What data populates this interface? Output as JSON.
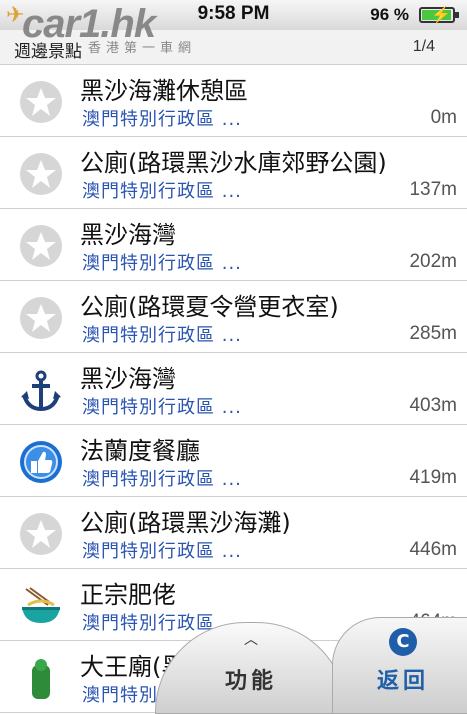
{
  "status_bar": {
    "time": "9:58 PM",
    "battery": "96 %"
  },
  "watermark": {
    "logo": "car1.hk",
    "subtitle": "香港第一車網"
  },
  "header": {
    "title": "週邊景點",
    "page": "1/4"
  },
  "list": [
    {
      "icon": "star-icon",
      "name": "黑沙海灘休憩區",
      "region": "澳門特別行政區 ...",
      "distance": "0m"
    },
    {
      "icon": "star-icon",
      "name": "公廁(路環黑沙水庫郊野公園)",
      "region": "澳門特別行政區 ...",
      "distance": "137m"
    },
    {
      "icon": "star-icon",
      "name": "黑沙海灣",
      "region": "澳門特別行政區 ...",
      "distance": "202m"
    },
    {
      "icon": "star-icon",
      "name": "公廁(路環夏令營更衣室)",
      "region": "澳門特別行政區 ...",
      "distance": "285m"
    },
    {
      "icon": "anchor-icon",
      "name": "黑沙海灣",
      "region": "澳門特別行政區 ...",
      "distance": "403m"
    },
    {
      "icon": "thumbs-up-icon",
      "name": "法蘭度餐廳",
      "region": "澳門特別行政區 ...",
      "distance": "419m"
    },
    {
      "icon": "star-icon",
      "name": "公廁(路環黑沙海灘)",
      "region": "澳門特別行政區 ...",
      "distance": "446m"
    },
    {
      "icon": "noodle-bowl-icon",
      "name": "正宗肥佬",
      "region": "澳門特別行政區 ...",
      "distance": "464m"
    },
    {
      "icon": "temple-icon",
      "name": "大王廟(黑沙)",
      "region": "澳門特別行政區 ...",
      "distance": ""
    }
  ],
  "bottom": {
    "function_label": "功能",
    "back_label": "返回"
  },
  "colors": {
    "region_text": "#2a54b2",
    "back_accent": "#1f5ea8"
  }
}
